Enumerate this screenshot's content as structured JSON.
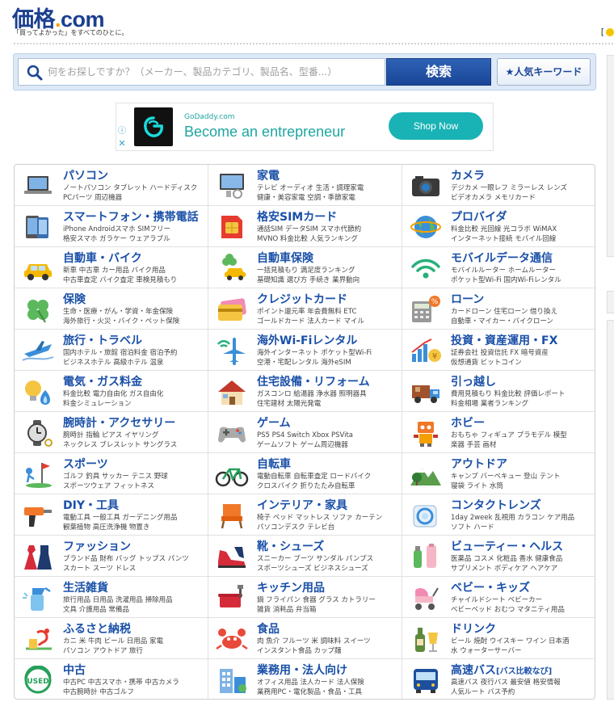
{
  "header": {
    "logo_jp": "価格",
    "logo_dot": ".",
    "logo_com": "com",
    "tagline": "「買ってよかった」をすべてのひとに。",
    "right_fragment": "["
  },
  "search": {
    "placeholder": "何をお探しですか？（メーカー、製品カテゴリ、製品名、型番...）",
    "button_label": "検索",
    "keyword_button_label": "★人気キーワード"
  },
  "ad": {
    "brand": "GoDaddy.com",
    "headline": "Become an entrepreneur",
    "cta": "Shop Now",
    "info_icon": "ⓘ",
    "close_icon": "✕"
  },
  "categories": [
    {
      "title": "パソコン",
      "sub": "",
      "links": "ノートパソコン タブレット ハードディスク\nPCパーツ 周辺機器",
      "icon": "laptop-icon"
    },
    {
      "title": "家電",
      "sub": "",
      "links": "テレビ オーディオ 生活・調理家電\n健康・美容家電 空調・季節家電",
      "icon": "tv-icon"
    },
    {
      "title": "カメラ",
      "sub": "",
      "links": "デジカメ 一眼レフ ミラーレス レンズ\nビデオカメラ メモリカード",
      "icon": "camera-icon"
    },
    {
      "title": "スマートフォン・携帯電話",
      "sub": "",
      "links": "iPhone Androidスマホ SIMフリー\n格安スマホ ガラケー ウェアラブル",
      "icon": "smartphone-icon"
    },
    {
      "title": "格安SIMカード",
      "sub": "",
      "links": "通話SIM データSIM スマホ代節約\nMVNO 料金比較 人気ランキング",
      "icon": "sim-card-icon"
    },
    {
      "title": "プロバイダ",
      "sub": "",
      "links": "料金比較 光回線 光コラボ WiMAX\nインターネット接続 モバイル回線",
      "icon": "globe-icon"
    },
    {
      "title": "自動車・バイク",
      "sub": "",
      "links": "新車 中古車 カー用品 バイク用品\n中古車査定 バイク査定 車検見積もり",
      "icon": "car-icon"
    },
    {
      "title": "自動車保険",
      "sub": "",
      "links": "一括見積もり 満足度ランキング\n基礎知識 選び方 手続き 業界動向",
      "icon": "car-insurance-icon"
    },
    {
      "title": "モバイルデータ通信",
      "sub": "",
      "links": "モバイルルーター ホームルーター\nポケット型Wi-Fi 国内Wi-Fiレンタル",
      "icon": "wifi-icon"
    },
    {
      "title": "保険",
      "sub": "",
      "links": "生命・医療・がん・学資・年金保険\n海外旅行・火災・バイク・ペット保険",
      "icon": "clover-icon"
    },
    {
      "title": "クレジットカード",
      "sub": "",
      "links": "ポイント還元率 年会費無料 ETC\nゴールドカード 法人カード マイル",
      "icon": "credit-card-icon"
    },
    {
      "title": "ローン",
      "sub": "",
      "links": "カードローン 住宅ローン 借り換え\n自動車・マイカー・バイクローン",
      "icon": "calculator-icon"
    },
    {
      "title": "旅行・トラベル",
      "sub": "",
      "links": "国内ホテル・旅館 宿泊料金 宿泊予約\nビジネスホテル 高級ホテル 温泉",
      "icon": "airplane-icon"
    },
    {
      "title": "海外Wi-Fiレンタル",
      "sub": "",
      "links": "海外インターネット ポケット型Wi-Fi\n空港・宅配レンタル 海外eSIM",
      "icon": "plane-wifi-icon"
    },
    {
      "title": "投資・資産運用・FX",
      "sub": "",
      "links": "証券会社 投資信託 FX 暗号資産\n仮想通貨 ビットコイン",
      "icon": "investment-chart-icon"
    },
    {
      "title": "電気・ガス料金",
      "sub": "",
      "links": "料金比較 電力自由化 ガス自由化\n料金シミュレーション",
      "icon": "lightbulb-flame-icon"
    },
    {
      "title": "住宅設備・リフォーム",
      "sub": "",
      "links": "ガスコンロ 給湯器 浄水器 照明器具\n住宅建材 太陽光発電",
      "icon": "house-icon"
    },
    {
      "title": "引っ越し",
      "sub": "",
      "links": "費用見積もり 料金比較 評価レポート\n料金相場 業者ランキング",
      "icon": "truck-icon"
    },
    {
      "title": "腕時計・アクセサリー",
      "sub": "",
      "links": "腕時計 指輪 ピアス イヤリング\nネックレス ブレスレット サングラス",
      "icon": "watch-icon"
    },
    {
      "title": "ゲーム",
      "sub": "",
      "links": "PS5 PS4 Switch Xbox PSVita\nゲームソフト ゲーム周辺機器",
      "icon": "gamepad-icon"
    },
    {
      "title": "ホビー",
      "sub": "",
      "links": "おもちゃ フィギュア プラモデル 模型\n楽器 手芸 画材",
      "icon": "robot-icon"
    },
    {
      "title": "スポーツ",
      "sub": "",
      "links": "ゴルフ 釣具 サッカー テニス 野球\nスポーツウェア フィットネス",
      "icon": "golf-icon"
    },
    {
      "title": "自転車",
      "sub": "",
      "links": "電動自転車 自転車査定 ロードバイク\nクロスバイク 折りたたみ自転車",
      "icon": "bicycle-icon"
    },
    {
      "title": "アウトドア",
      "sub": "",
      "links": "キャンプ バーベキュー 登山 テント\n寝袋 ライト 水筒",
      "icon": "mountain-icon"
    },
    {
      "title": "DIY・工具",
      "sub": "",
      "links": "電動工具 一般工具 ガーデニング用品\n観葉植物 高圧洗浄機 物置き",
      "icon": "drill-icon"
    },
    {
      "title": "インテリア・家具",
      "sub": "",
      "links": "椅子 ベッド マットレス ソファ カーテン\nパソコンデスク テレビ台",
      "icon": "chair-icon"
    },
    {
      "title": "コンタクトレンズ",
      "sub": "",
      "links": "1day 2week 乱視用 カラコン ケア用品\nソフト ハード",
      "icon": "contact-lens-icon"
    },
    {
      "title": "ファッション",
      "sub": "",
      "links": "ブランド品 財布 バッグ トップス パンツ\nスカート スーツ ドレス",
      "icon": "dress-icon"
    },
    {
      "title": "靴・シューズ",
      "sub": "",
      "links": "スニーカー ブーツ サンダル パンプス\nスポーツシューズ ビジネスシューズ",
      "icon": "shoe-icon"
    },
    {
      "title": "ビューティー・ヘルス",
      "sub": "",
      "links": "医薬品 コスメ 化粧品 香水 健康食品\nサプリメント ボディケア ヘアケア",
      "icon": "cosmetics-icon"
    },
    {
      "title": "生活雑貨",
      "sub": "",
      "links": "旅行用品 日用品 洗濯用品 掃除用品\n文具 介護用品 常備品",
      "icon": "spray-bottle-icon"
    },
    {
      "title": "キッチン用品",
      "sub": "",
      "links": "鍋 フライパン 食器 グラス カトラリー\n雑貨 消耗品 弁当箱",
      "icon": "pot-icon"
    },
    {
      "title": "ベビー・キッズ",
      "sub": "",
      "links": "チャイルドシート ベビーカー\nベビーベッド おむつ マタニティ用品",
      "icon": "stroller-icon"
    },
    {
      "title": "ふるさと納税",
      "sub": "",
      "links": "カニ 米 牛肉 ビール 日用品 家電\nパソコン アウトドア 旅行",
      "icon": "furusato-icon"
    },
    {
      "title": "食品",
      "sub": "",
      "links": "肉 魚介 フルーツ 米 調味料 スイーツ\nインスタント食品 カップ麺",
      "icon": "crab-icon"
    },
    {
      "title": "ドリンク",
      "sub": "",
      "links": "ビール 焼酎 ウイスキー ワイン 日本酒\n水 ウォーターサーバー",
      "icon": "drink-bottle-icon"
    },
    {
      "title": "中古",
      "sub": "",
      "links": "中古PC 中古スマホ・携帯 中古カメラ\n中古腕時計 中古ゴルフ",
      "icon": "used-icon"
    },
    {
      "title": "業務用・法人向け",
      "sub": "",
      "links": "オフィス用品 法人カード 法人保険\n業務用PC・電化製品・食品・工具",
      "icon": "office-building-icon"
    },
    {
      "title": "高速バス",
      "sub": "[バス比較なび]",
      "links": "高速バス 夜行バス 最安値 格安情報\n人気ルート バス予約",
      "icon": "bus-icon"
    }
  ]
}
